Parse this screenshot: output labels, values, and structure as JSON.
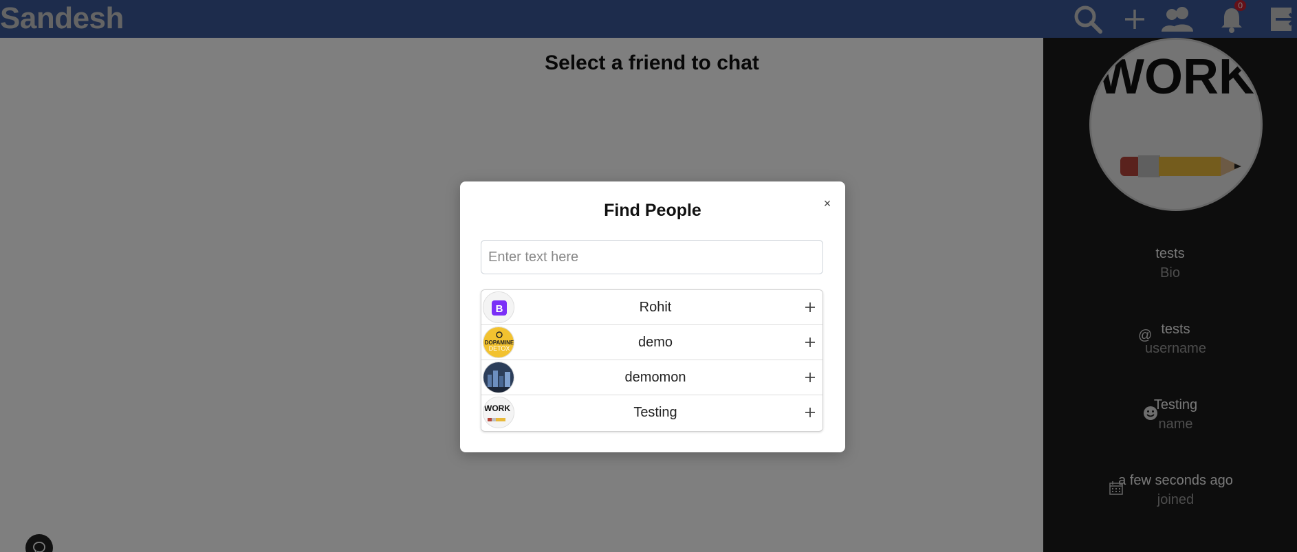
{
  "navbar": {
    "brand": "Sandesh",
    "notification_count": "0",
    "icons": [
      "search-icon",
      "plus-icon",
      "people-icon",
      "bell-icon",
      "logout-icon"
    ]
  },
  "main": {
    "title": "Select a friend to chat"
  },
  "profile": {
    "picture_text": "WORK",
    "bio": {
      "value": "tests",
      "label": "Bio"
    },
    "username": {
      "value": "tests",
      "label": "username",
      "icon": "at-icon"
    },
    "name": {
      "value": "Testing",
      "label": "name",
      "icon": "smile-icon"
    },
    "joined": {
      "value": "a few seconds ago",
      "label": "joined",
      "icon": "calendar-icon"
    }
  },
  "modal": {
    "title": "Find People",
    "close_label": "×",
    "search": {
      "placeholder": "Enter text here",
      "value": ""
    },
    "people": [
      {
        "name": "Rohit",
        "avatar": "bootstrap-logo",
        "avatar_text": "B"
      },
      {
        "name": "demo",
        "avatar": "dopamine-detox",
        "avatar_text_1": "DOPAMINE",
        "avatar_text_2": "DETOX"
      },
      {
        "name": "demomon",
        "avatar": "city-night"
      },
      {
        "name": "Testing",
        "avatar": "work-pencil",
        "avatar_text": "WORK"
      }
    ]
  },
  "colors": {
    "navbar": "#3b5998",
    "brand_text": "#c9c9c9",
    "badge": "#c82333",
    "right_panel": "#1a1a1a"
  }
}
